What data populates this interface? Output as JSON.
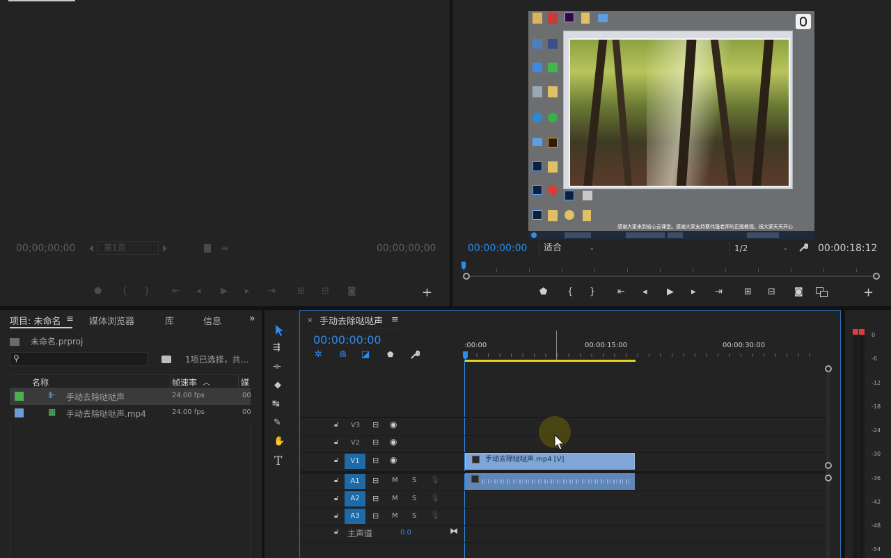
{
  "source_monitor": {
    "timecode_left": "00;00;00;00",
    "page_select": "第1页",
    "timecode_right": "00;00;00;00"
  },
  "program_monitor": {
    "timecode_current": "00:00:00:00",
    "fit_select": "适合",
    "resolution_select": "1/2",
    "timecode_duration": "00:00:18:12",
    "video_caption": "感谢大家来到省心云课堂。感谢大家支持蔡伟强老师的正版教程。祝大家天天开心"
  },
  "project_panel": {
    "tabs": [
      "项目: 未命名",
      "媒体浏览器",
      "库",
      "信息"
    ],
    "project_file": "未命名.prproj",
    "selection_status": "1项已选择，共...",
    "columns": [
      "名称",
      "帧速率",
      "媒"
    ],
    "items": [
      {
        "name": "手动去除哒哒声",
        "fps": "24.00 fps",
        "extra": "00",
        "color": "#4caf50"
      },
      {
        "name": "手动去除哒哒声.mp4",
        "fps": "24.00 fps",
        "extra": "00",
        "color": "#6b9bd8"
      }
    ]
  },
  "timeline": {
    "sequence_name": "手动去除哒哒声",
    "timecode": "00:00:00:00",
    "ruler_labels": [
      ":00:00",
      "00:00:15:00",
      "00:00:30:00"
    ],
    "video_tracks": [
      "V3",
      "V2",
      "V1"
    ],
    "audio_tracks": [
      "A1",
      "A2",
      "A3"
    ],
    "mute_label": "M",
    "solo_label": "S",
    "master_label": "主声道",
    "master_value": "0.0",
    "video_clip_label": "手动去除哒哒声.mp4 [V]"
  },
  "audio_meter": {
    "ticks": [
      "0",
      "-6",
      "-12",
      "-18",
      "-24",
      "-30",
      "-36",
      "-42",
      "-48",
      "-54"
    ]
  },
  "colors": {
    "accent_blue": "#2d8ceb",
    "track_target": "#1e6aa6",
    "clip_video": "#7fa6d6",
    "clip_audio": "#5f86b8",
    "work_area": "#e8d21a"
  }
}
